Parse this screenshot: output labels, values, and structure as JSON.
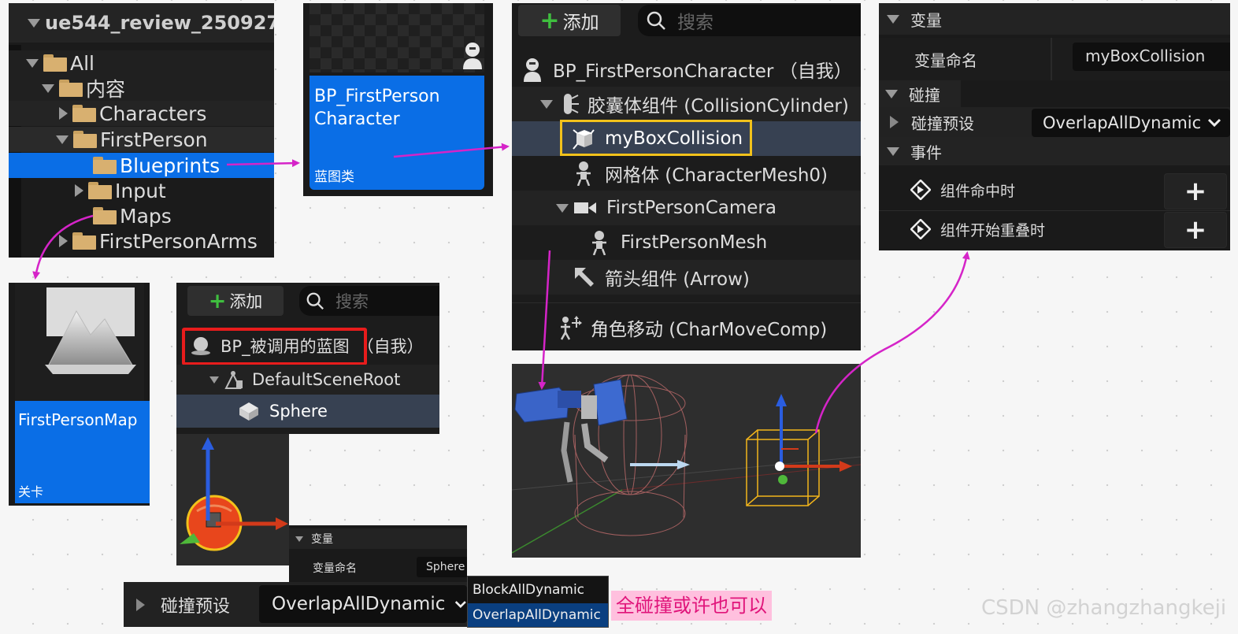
{
  "content_browser": {
    "title": "ue544_review_250927",
    "tree": {
      "all": "All",
      "content": "内容",
      "characters": "Characters",
      "first_person": "FirstPerson",
      "blueprints": "Blueprints",
      "input": "Input",
      "maps": "Maps",
      "first_person_arms": "FirstPersonArms"
    }
  },
  "asset_bp": {
    "name": "BP_FirstPerson Character",
    "type": "蓝图类"
  },
  "asset_map": {
    "name": "FirstPersonMap",
    "type": "关卡"
  },
  "components_main": {
    "add_label": "添加",
    "search_placeholder": "搜索",
    "items": [
      "BP_FirstPersonCharacter （自我）",
      "胶囊体组件 (CollisionCylinder)",
      "myBoxCollision",
      "网格体 (CharacterMesh0)",
      "FirstPersonCamera",
      "FirstPersonMesh",
      "箭头组件 (Arrow)",
      "角色移动 (CharMoveComp)"
    ]
  },
  "components_small": {
    "add_label": "添加",
    "search_placeholder": "搜索",
    "root_name": "BP_被调用的蓝图",
    "root_suffix": "（自我）",
    "items": [
      "DefaultSceneRoot",
      "Sphere"
    ]
  },
  "details_main": {
    "section_variable": "变量",
    "variable_name_label": "变量命名",
    "variable_name_value": "myBoxCollision",
    "section_collision": "碰撞",
    "collision_preset_label": "碰撞预设",
    "collision_preset_value": "OverlapAllDynamic",
    "section_events": "事件",
    "events": [
      "组件命中时",
      "组件开始重叠时"
    ]
  },
  "details_small": {
    "section_variable": "变量",
    "variable_name_label": "变量命名",
    "variable_name_value": "Sphere"
  },
  "collision_bar": {
    "label": "碰撞预设",
    "value": "OverlapAllDynamic",
    "options": [
      "BlockAllDynamic",
      "OverlapAllDynamic"
    ]
  },
  "annotation": "全碰撞或许也可以",
  "watermark": "CSDN @zhangzhangkeji",
  "colors": {
    "selection_blue": "#0a6ee6",
    "highlight_red": "#e81c1c",
    "outline_yellow": "#f2c21b",
    "arrow_magenta": "#d524c8",
    "annotation_bg": "#ffc0de"
  }
}
